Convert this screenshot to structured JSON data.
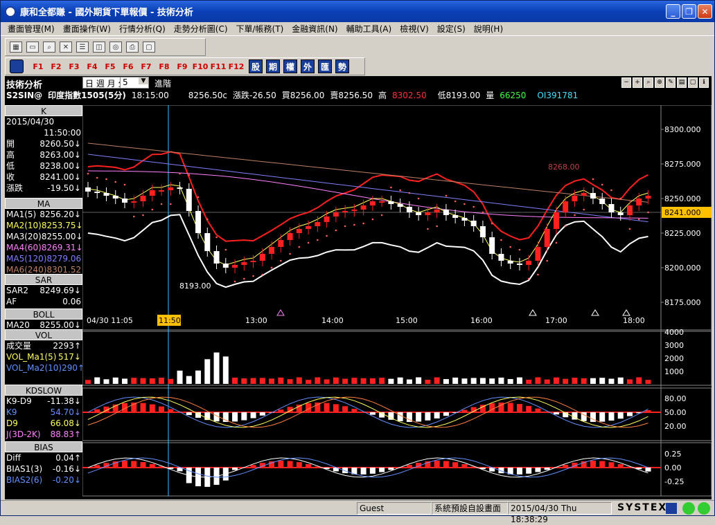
{
  "window": {
    "title": "康和全都賺 - 國外期貨下單報價 - 技術分析"
  },
  "menu": [
    "畫面管理(M)",
    "畫面操作(W)",
    "行情分析(Q)",
    "走勢分析圖(C)",
    "下單/帳務(T)",
    "金融資訊(N)",
    "輔助工具(A)",
    "檢視(V)",
    "設定(S)",
    "說明(H)"
  ],
  "fkeys": [
    "F1",
    "F2",
    "F3",
    "F4",
    "F5",
    "F6",
    "F7",
    "F8",
    "F9",
    "F10",
    "F11",
    "F12"
  ],
  "quick": [
    "股",
    "期",
    "權",
    "外",
    "匯",
    "勢"
  ],
  "header": {
    "name": "技術分析",
    "periods": "日 週 月 分",
    "interval": "5",
    "advanced": "進階",
    "symbol": "S2SIN@",
    "symbol_name": "印度指數1505(5分)",
    "time": "18:15:00",
    "last": "8256.50c",
    "chg": "漲跌-26.50",
    "bid": "買8256.00",
    "ask": "賣8256.50",
    "high_label": "高",
    "high": "8302.50",
    "low": "低8193.00",
    "vol_label": "量",
    "vol": "66250",
    "oi": "OI391781"
  },
  "left": {
    "k": {
      "title": "K",
      "date": "2015/04/30",
      "time": "11:50:00",
      "rows": [
        {
          "l": "開",
          "v": "8260.50↓"
        },
        {
          "l": "高",
          "v": "8263.00↓"
        },
        {
          "l": "低",
          "v": "8238.00↓"
        },
        {
          "l": "收",
          "v": "8241.00↓"
        },
        {
          "l": "漲跌",
          "v": "-19.50↓"
        }
      ]
    },
    "ma": {
      "title": "MA",
      "rows": [
        {
          "l": "MA1(5)",
          "v": "8256.20↓",
          "c": "#ffffff"
        },
        {
          "l": "MA2(10)",
          "v": "8253.75↓",
          "c": "#ffff60"
        },
        {
          "l": "MA3(20)",
          "v": "8255.00↓",
          "c": "#ffffff"
        },
        {
          "l": "MA4(60)",
          "v": "8269.31↓",
          "c": "#ff80ff"
        },
        {
          "l": "MA5(120)",
          "v": "8279.06↓",
          "c": "#8080ff"
        },
        {
          "l": "MA6(240)",
          "v": "8301.52↓",
          "c": "#c08060"
        }
      ]
    },
    "sar": {
      "title": "SAR",
      "rows": [
        {
          "l": "SAR2",
          "v": "8249.69↓"
        },
        {
          "l": "AF",
          "v": "0.06"
        }
      ]
    },
    "boll": {
      "title": "BOLL",
      "rows": [
        {
          "l": "MA20",
          "v": "8255.00↓"
        }
      ]
    },
    "vol": {
      "title": "VOL",
      "rows": [
        {
          "l": "成交量",
          "v": "2293↑",
          "c": "#ffffff"
        },
        {
          "l": "VOL_Ma1(5)",
          "v": "517↓",
          "c": "#ffff60"
        },
        {
          "l": "VOL_Ma2(10)",
          "v": "290↑",
          "c": "#6090ff"
        }
      ]
    },
    "kd": {
      "title": "KDSLOW",
      "rows": [
        {
          "l": "K9-D9",
          "v": "-11.38↓",
          "c": "#ffffff"
        },
        {
          "l": "K9",
          "v": "54.70↓",
          "c": "#6090ff"
        },
        {
          "l": "D9",
          "v": "66.08↓",
          "c": "#ffff60"
        },
        {
          "l": "J(3D-2K)",
          "v": "88.83↑",
          "c": "#ff80ff"
        }
      ]
    },
    "bias": {
      "title": "BIAS",
      "rows": [
        {
          "l": "Diff",
          "v": "0.04↑",
          "c": "#ffffff"
        },
        {
          "l": "BIAS1(3)",
          "v": "-0.16↓",
          "c": "#ffffff"
        },
        {
          "l": "BIAS2(6)",
          "v": "-0.20↓",
          "c": "#6090ff"
        }
      ]
    }
  },
  "price_axis": [
    "8300.000",
    "8275.000",
    "8250.000",
    "8225.000",
    "8200.000",
    "8175.000"
  ],
  "current_price": "8241.000",
  "low_marker": "8193.00",
  "ma_label": "8268.00",
  "time_axis": [
    "04/30 11:05",
    "11:50:00",
    "13:00",
    "14:00",
    "15:00",
    "16:00",
    "17:00",
    "18:00"
  ],
  "vol_axis": [
    "4000",
    "3000",
    "2000",
    "1000"
  ],
  "kd_axis": [
    "80.00",
    "50.00",
    "20.00"
  ],
  "bias_axis": [
    "0.25",
    "0.00",
    "-0.25"
  ],
  "status": {
    "user": "Guest",
    "layout": "系統預設自設畫面",
    "datetime": "2015/04/30 Thu 18:38:29",
    "brand": "SYSTEX"
  },
  "colors": {
    "up": "#ff2020",
    "down": "#ffffff",
    "bg": "#000000"
  }
}
